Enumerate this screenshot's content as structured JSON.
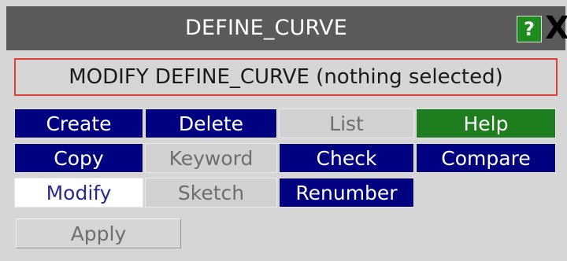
{
  "window": {
    "title": "DEFINE_CURVE",
    "help_icon": "?",
    "close_icon": "X"
  },
  "status": {
    "text": "MODIFY DEFINE_CURVE (nothing selected)"
  },
  "buttons": {
    "create": "Create",
    "delete": "Delete",
    "list": "List",
    "help": "Help",
    "copy": "Copy",
    "keyword": "Keyword",
    "check": "Check",
    "compare": "Compare",
    "modify": "Modify",
    "sketch": "Sketch",
    "renumber": "Renumber",
    "apply": "Apply"
  },
  "colors": {
    "title_bar": "#5a5a5a",
    "active_button": "#000080",
    "help_button": "#1e7d1e",
    "status_border": "#e0403a",
    "panel_bg": "#d6d6d6"
  }
}
